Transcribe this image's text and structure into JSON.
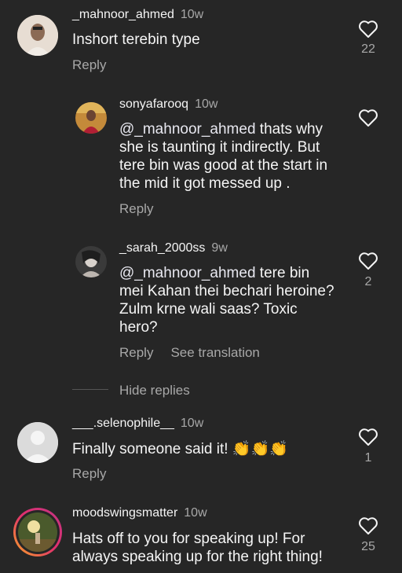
{
  "comments": [
    {
      "username": "_mahnoor_ahmed",
      "time": "10w",
      "text": "Inshort terebin type",
      "reply": "Reply",
      "likes": "22"
    },
    {
      "username": "sonyafarooq",
      "time": "10w",
      "mention": "@_mahnoor_ahmed",
      "text_line1_rest": " thats why",
      "text_line2": "she is taunting it indirectly. But",
      "text_line3": "tere bin was good at the start in",
      "text_line4": "the mid it got messed up .",
      "reply": "Reply"
    },
    {
      "username": "_sarah_2000ss",
      "time": "9w",
      "mention": "@_mahnoor_ahmed",
      "text_line1_rest": " tere bin",
      "text_line2": "mei Kahan thei bechari heroine?",
      "text_line3": "Zulm krne wali saas? Toxic",
      "text_line4": "hero?",
      "reply": "Reply",
      "see_translation": "See translation",
      "likes": "2"
    },
    {
      "username": "___.selenophile__",
      "time": "10w",
      "text": "Finally someone said it!",
      "emoji": "👏👏👏",
      "reply": "Reply",
      "likes": "1"
    },
    {
      "username": "moodswingsmatter",
      "time": "10w",
      "text_line1": "Hats off to you for speaking up! For",
      "text_line2": "always speaking up for the right thing!",
      "likes": "25"
    }
  ],
  "hide_replies": "Hide replies",
  "colors": {
    "background": "#262626",
    "secondary_text": "#a8a8a8",
    "primary_text": "#f5f5f5"
  }
}
